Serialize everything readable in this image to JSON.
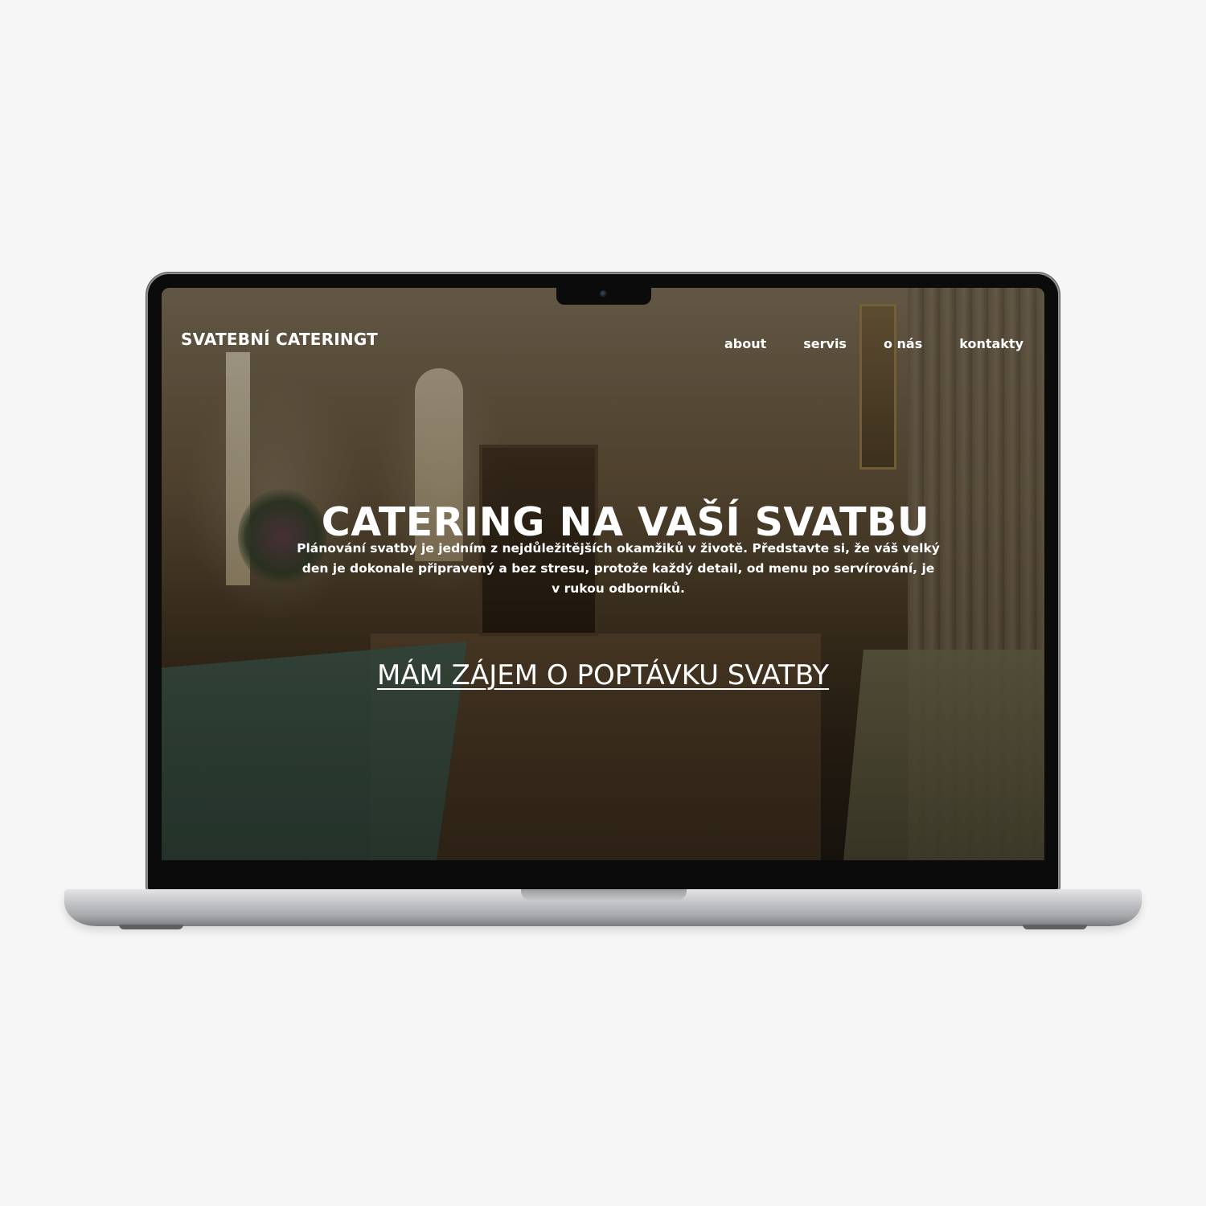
{
  "site": {
    "brand": "SVATEBNÍ CATERINGT",
    "nav": {
      "items": [
        {
          "label": "about"
        },
        {
          "label": "servis"
        },
        {
          "label": "o nás"
        },
        {
          "label": "kontakty"
        }
      ]
    },
    "hero": {
      "title": "CATERING NA VAŠÍ SVATBU",
      "text": "Plánování svatby je jedním z nejdůležitějších okamžiků v životě. Představte si, že váš velký den je dokonale připravený a bez stresu, protože každý detail, od menu po servírování, je v rukou odborníků.",
      "cta": "MÁM ZÁJEM O POPTÁVKU SVATBY"
    }
  },
  "colors": {
    "background": "#f6f6f6",
    "bezel": "#0b0b0c",
    "aluminum": "#c9cacd",
    "hero_text": "#ffffff"
  },
  "icons": {
    "camera": "camera-icon"
  }
}
